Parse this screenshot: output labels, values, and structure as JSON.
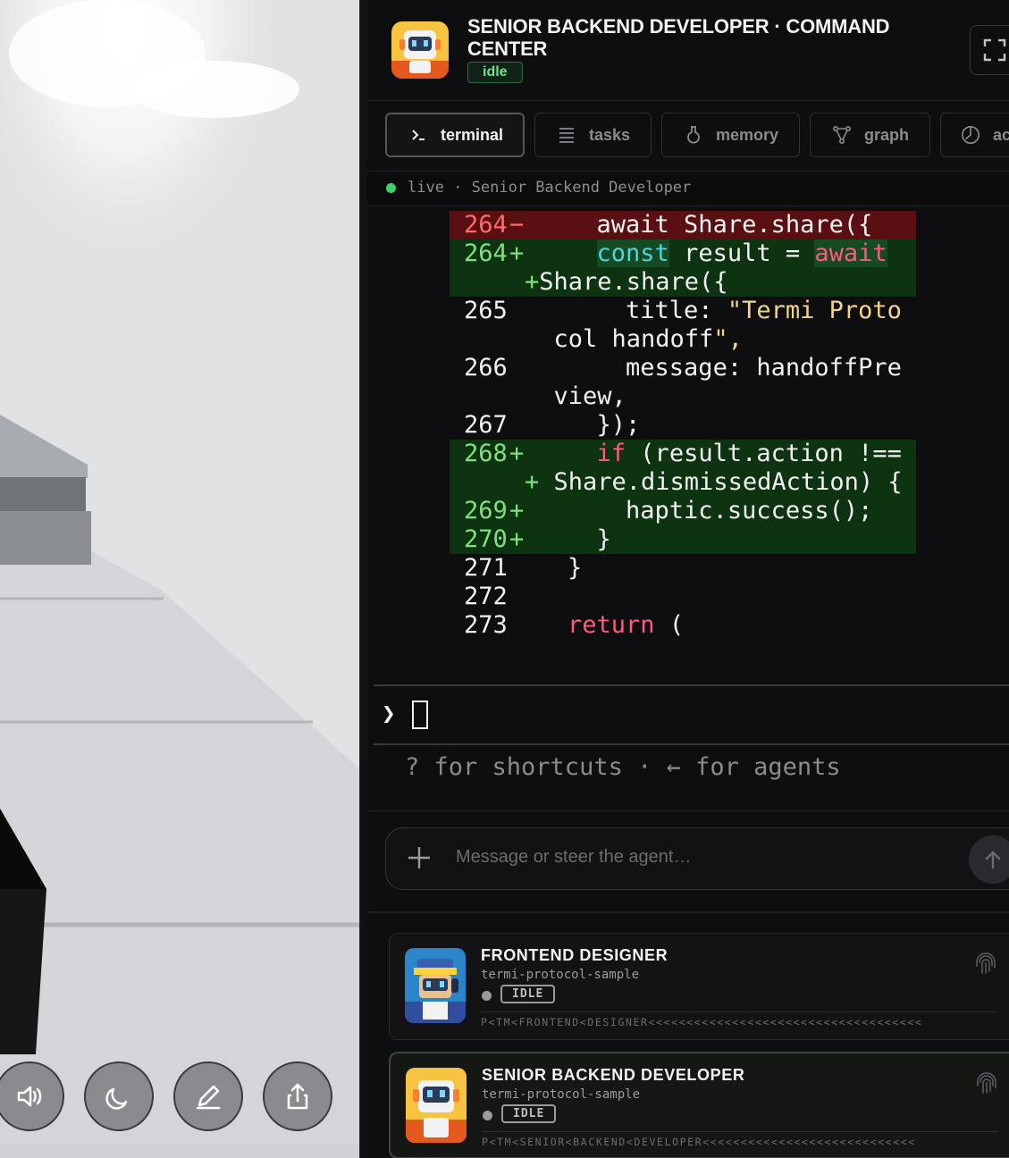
{
  "header": {
    "title": "SENIOR BACKEND DEVELOPER · COMMAND CENTER",
    "status": "idle",
    "expand_icon": "expand-icon"
  },
  "tabs": [
    {
      "label": "terminal",
      "icon": "terminal-icon",
      "active": true
    },
    {
      "label": "tasks",
      "icon": "list-icon",
      "active": false
    },
    {
      "label": "memory",
      "icon": "flask-icon",
      "active": false
    },
    {
      "label": "graph",
      "icon": "graph-icon",
      "active": false
    },
    {
      "label": "ac",
      "icon": "clock-icon",
      "active": false
    }
  ],
  "live": {
    "text": "live · Senior Backend Developer"
  },
  "diff": [
    {
      "ln": "264",
      "mk": "−",
      "type": "del",
      "content": "    await Share.share({"
    },
    {
      "ln": "264",
      "mk": "+",
      "type": "add",
      "content": "    const result = await"
    },
    {
      "ln": "",
      "mk": "+",
      "type": "add",
      "content": "Share.share({"
    },
    {
      "ln": "265",
      "mk": "",
      "type": "ctx",
      "content": "      title: \"Termi Proto"
    },
    {
      "ln": "",
      "mk": "",
      "type": "ctx",
      "content": " col handoff\","
    },
    {
      "ln": "266",
      "mk": "",
      "type": "ctx",
      "content": "      message: handoffPre"
    },
    {
      "ln": "",
      "mk": "",
      "type": "ctx",
      "content": " view,"
    },
    {
      "ln": "267",
      "mk": "",
      "type": "ctx",
      "content": "    });"
    },
    {
      "ln": "268",
      "mk": "+",
      "type": "add",
      "content": "    if (result.action !=="
    },
    {
      "ln": "",
      "mk": "+",
      "type": "add",
      "content": " Share.dismissedAction) {"
    },
    {
      "ln": "269",
      "mk": "+",
      "type": "add",
      "content": "      haptic.success();"
    },
    {
      "ln": "270",
      "mk": "+",
      "type": "add",
      "content": "    }"
    },
    {
      "ln": "271",
      "mk": "",
      "type": "ctx",
      "content": "  }"
    },
    {
      "ln": "272",
      "mk": "",
      "type": "ctx",
      "content": ""
    },
    {
      "ln": "273",
      "mk": "",
      "type": "ctx",
      "content": "  return ("
    }
  ],
  "terminal": {
    "prompt": "❯",
    "hint": "? for shortcuts · ← for agents"
  },
  "composer": {
    "placeholder": "Message or steer the agent…",
    "add_icon": "plus-icon",
    "send_icon": "arrow-up-icon"
  },
  "agents": [
    {
      "name": "FRONTEND DESIGNER",
      "project": "termi-protocol-sample",
      "status": "IDLE",
      "mrz": "P<TM<FRONTEND<DESIGNER<<<<<<<<<<<<<<<<<<<<<<<<<<<<<<<<<<<<",
      "icon": "fingerprint-icon"
    },
    {
      "name": "SENIOR BACKEND DEVELOPER",
      "project": "termi-protocol-sample",
      "status": "IDLE",
      "mrz": "P<TM<SENIOR<BACKEND<DEVELOPER<<<<<<<<<<<<<<<<<<<<<<<<<<<<",
      "icon": "fingerprint-icon"
    }
  ],
  "scene_controls": [
    {
      "icon": "speaker-icon"
    },
    {
      "icon": "moon-icon"
    },
    {
      "icon": "pencil-icon"
    },
    {
      "icon": "share-icon"
    }
  ]
}
